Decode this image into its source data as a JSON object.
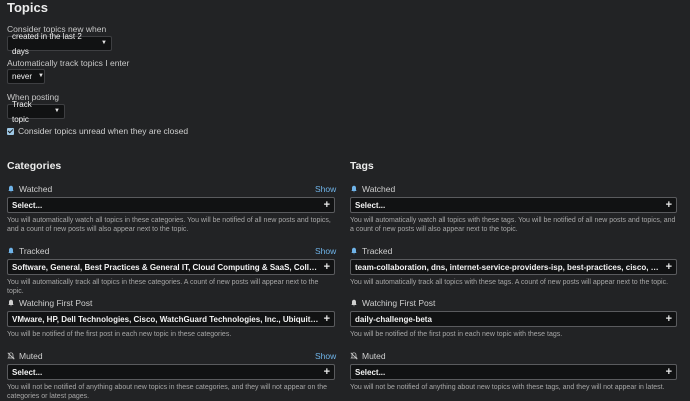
{
  "topics": {
    "title": "Topics",
    "consider_new_label": "Consider topics new when",
    "consider_new_value": "created in the last 2 days",
    "auto_track_label": "Automatically track topics I enter",
    "auto_track_value": "never",
    "when_posting_label": "When posting",
    "when_posting_value": "Track topic",
    "unread_checkbox_label": "Consider topics unread when they are closed"
  },
  "categories": {
    "title": "Categories",
    "show_label": "Show",
    "watched": {
      "label": "Watched",
      "value": "Select...",
      "help": "You will automatically watch all topics in these categories. You will be notified of all new posts and topics, and a count of new posts will also appear next to the topic."
    },
    "tracked": {
      "label": "Tracked",
      "value": "Software, General, Best Practices & General IT, Cloud Computing & SaaS, Collaboration, IT Programming",
      "help": "You will automatically track all topics in these categories. A count of new posts will appear next to the topic."
    },
    "watching_first_post": {
      "label": "Watching First Post",
      "value": "VMware, HP, Dell Technologies, Cisco, WatchGuard Technologies, Inc., Ubiquiti Inc., HPE, Microsoft",
      "help": "You will be notified of the first post in each new topic in these categories."
    },
    "muted": {
      "label": "Muted",
      "value": "Select...",
      "help": "You will not be notified of anything about new topics in these categories, and they will not appear on the categories or latest pages."
    }
  },
  "tags": {
    "title": "Tags",
    "watched": {
      "label": "Watched",
      "value": "Select...",
      "help": "You will automatically watch all topics with these tags. You will be notified of all new posts and topics, and a count of new posts will also appear next to the topic."
    },
    "tracked": {
      "label": "Tracked",
      "value": "team-collaboration, dns, internet-service-providers-isp, best-practices, cisco, powershell, windows-server",
      "help": "You will automatically track all topics with these tags. A count of new posts will appear next to the topic."
    },
    "watching_first_post": {
      "label": "Watching First Post",
      "value": "daily-challenge-beta",
      "help": "You will be notified of the first post in each new topic with these tags."
    },
    "muted": {
      "label": "Muted",
      "value": "Select...",
      "help": "You will not be notified of anything about new topics with these tags, and they will not appear in latest."
    }
  },
  "colors": {
    "link": "#6fb3e8",
    "watched_icon": "#6fb3e8",
    "background": "#222325"
  }
}
